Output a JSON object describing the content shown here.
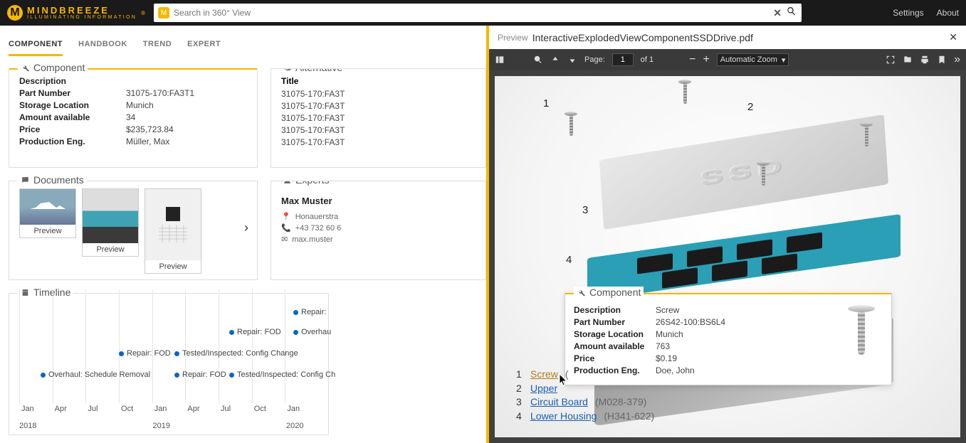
{
  "brand": {
    "name": "MINDBREEZE",
    "tag": "ILLUMINATING INFORMATION"
  },
  "search": {
    "placeholder": "Search in 360° View"
  },
  "nav": {
    "settings": "Settings",
    "about": "About"
  },
  "tabs": {
    "t0": "COMPONENT",
    "t1": "HANDBOOK",
    "t2": "TREND",
    "t3": "EXPERT"
  },
  "sections": {
    "component": "Component",
    "alternative": "Alternative",
    "documents": "Documents",
    "experts": "Experts",
    "timeline": "Timeline"
  },
  "component": {
    "desc_k": "Description",
    "desc_v": "",
    "pn_k": "Part Number",
    "pn_v": "31075-170:FA3T1",
    "sl_k": "Storage Location",
    "sl_v": "Munich",
    "aa_k": "Amount available",
    "aa_v": "34",
    "pr_k": "Price",
    "pr_v": "$235,723.84",
    "pe_k": "Production Eng.",
    "pe_v": "Müller, Max"
  },
  "alternative": {
    "title_k": "Title",
    "l0": "31075-170:FA3T",
    "l1": "31075-170:FA3T",
    "l2": "31075-170:FA3T",
    "l3": "31075-170:FA3T",
    "l4": "31075-170:FA3T"
  },
  "docs": {
    "preview": "Preview"
  },
  "expert": {
    "name": "Max Muster",
    "addr": "Honauerstra",
    "phone": "+43 732 60 6",
    "mail": "max.muster"
  },
  "timeline": {
    "e0": "Repair:",
    "e1": "Repair: FOD",
    "e2": "Overhau",
    "e3": "Repair: FOD",
    "e4": "Tested/Inspected: Config Change",
    "e5": "Overhaul: Schedule Removal",
    "e6": "Repair: FOD",
    "e7": "Tested/Inspected: Config Ch",
    "months": {
      "m0": "Jan",
      "m1": "Apr",
      "m2": "Jul",
      "m3": "Oct"
    },
    "years": {
      "y0": "2018",
      "y1": "2019",
      "y2": "2020"
    }
  },
  "preview": {
    "label": "Preview",
    "filename": "InteractiveExplodedViewComponentSSDDrive.pdf"
  },
  "pdf": {
    "page_label": "Page:",
    "page_num": "1",
    "page_of": "of 1",
    "zoom": "Automatic Zoom"
  },
  "overlay": {
    "title": "Component",
    "desc_k": "Description",
    "desc_v": "Screw",
    "pn_k": "Part Number",
    "pn_v": "26S42-100:BS6L4",
    "sl_k": "Storage Location",
    "sl_v": "Munich",
    "aa_k": "Amount available",
    "aa_v": "763",
    "pr_k": "Price",
    "pr_v": "$0.19",
    "pe_k": "Production Eng.",
    "pe_v": "Doe, John"
  },
  "parts": {
    "n1": "1",
    "p1": "Screw",
    "c1": "(",
    "n2": "2",
    "p2": "Upper",
    "n3": "3",
    "p3": "Circuit Board",
    "c3": "(M028-379)",
    "n4": "4",
    "p4": "Lower Housing",
    "c4": "(H341-622)"
  },
  "callouts": {
    "c1": "1",
    "c2": "2",
    "c3": "3",
    "c4": "4"
  },
  "ssd": "SSD"
}
